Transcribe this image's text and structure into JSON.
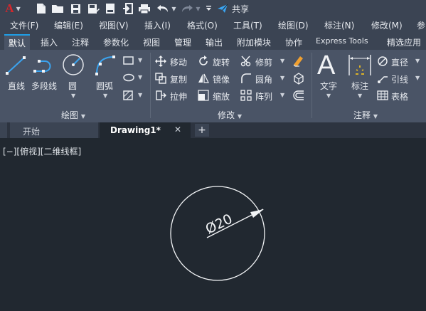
{
  "app": {
    "logo_letter": "A"
  },
  "quick_access": {
    "share_label": "共享",
    "icons": [
      "new-icon",
      "open-icon",
      "save-icon",
      "save-as-icon",
      "web-icon",
      "import-icon",
      "print-icon",
      "undo-icon",
      "redo-icon",
      "share-icon"
    ]
  },
  "menu": [
    "文件(F)",
    "编辑(E)",
    "视图(V)",
    "插入(I)",
    "格式(O)",
    "工具(T)",
    "绘图(D)",
    "标注(N)",
    "修改(M)",
    "参"
  ],
  "ribbon_tabs": [
    "默认",
    "插入",
    "注释",
    "参数化",
    "视图",
    "管理",
    "输出",
    "附加模块",
    "协作",
    "Express Tools",
    "精选应用"
  ],
  "draw_panel": {
    "title": "绘图",
    "line": "直线",
    "polyline": "多段线",
    "circle": "圆",
    "arc": "圆弧"
  },
  "modify_panel": {
    "title": "修改",
    "move": "移动",
    "rotate": "旋转",
    "trim": "修剪",
    "copy": "复制",
    "mirror": "镜像",
    "fillet": "圆角",
    "stretch": "拉伸",
    "scale": "缩放",
    "array": "阵列"
  },
  "annotation_panel": {
    "title": "注释",
    "text": "文字",
    "dimension": "标注",
    "text_glyph": "A",
    "diameter": "直径",
    "leader": "引线",
    "table": "表格"
  },
  "doc_tabs": {
    "start": "开始",
    "drawing": "Drawing1*",
    "close": "✕",
    "add": "+"
  },
  "viewport": {
    "label": "[−][俯视][二维线框]",
    "dimension_text": "Ø20"
  },
  "colors": {
    "accent": "#1e9ee6",
    "logo_red": "#d5272c",
    "share_blue": "#3ba4f0"
  }
}
